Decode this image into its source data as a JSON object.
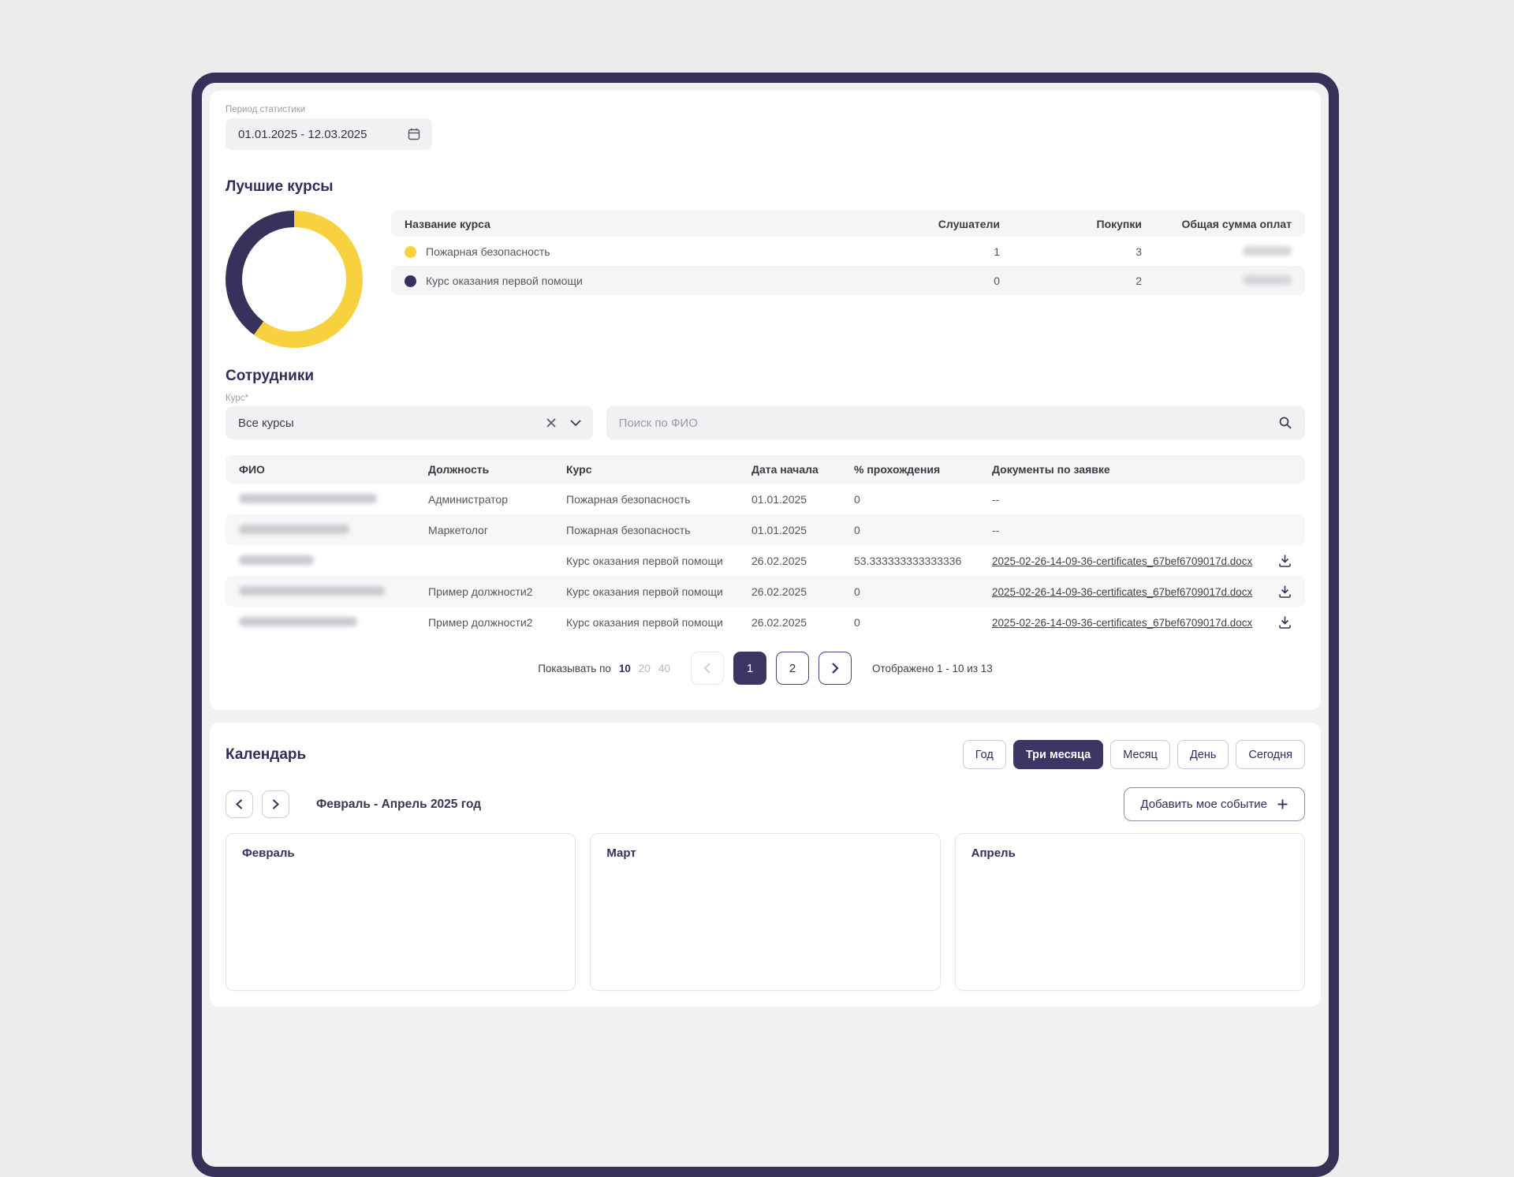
{
  "period": {
    "label": "Период статистики",
    "value": "01.01.2025 - 12.03.2025"
  },
  "best_courses": {
    "title": "Лучшие курсы",
    "chart_data": {
      "type": "pie",
      "categories": [
        "Пожарная безопасность",
        "Курс оказания первой помощи"
      ],
      "values": [
        3,
        2
      ],
      "colors": [
        "#F7D13E",
        "#37325B"
      ],
      "title": "Лучшие курсы"
    },
    "headers": {
      "name": "Название курса",
      "listeners": "Слушатели",
      "purchases": "Покупки",
      "total": "Общая сумма оплат"
    },
    "rows": [
      {
        "name": "Пожарная безопасность",
        "listeners": "1",
        "purchases": "3"
      },
      {
        "name": "Курс оказания первой помощи",
        "listeners": "0",
        "purchases": "2"
      }
    ]
  },
  "employees": {
    "title": "Сотрудники",
    "course_filter": {
      "label": "Курс*",
      "value": "Все курсы"
    },
    "search_placeholder": "Поиск по ФИО",
    "headers": {
      "fio": "ФИО",
      "position": "Должность",
      "course": "Курс",
      "start": "Дата начала",
      "progress": "% прохождения",
      "docs": "Документы по заявке"
    },
    "rows": [
      {
        "position": "Администратор",
        "course": "Пожарная безопасность",
        "start": "01.01.2025",
        "progress": "0",
        "doc": "--"
      },
      {
        "position": "Маркетолог",
        "course": "Пожарная безопасность",
        "start": "01.01.2025",
        "progress": "0",
        "doc": "--"
      },
      {
        "position": "",
        "course": "Курс оказания первой помощи",
        "start": "26.02.2025",
        "progress": "53.333333333333336",
        "doc": "2025-02-26-14-09-36-certificates_67bef6709017d.docx"
      },
      {
        "position": "Пример должности2",
        "course": "Курс оказания первой помощи",
        "start": "26.02.2025",
        "progress": "0",
        "doc": "2025-02-26-14-09-36-certificates_67bef6709017d.docx"
      },
      {
        "position": "Пример должности2",
        "course": "Курс оказания первой помощи",
        "start": "26.02.2025",
        "progress": "0",
        "doc": "2025-02-26-14-09-36-certificates_67bef6709017d.docx"
      }
    ],
    "pagination": {
      "show_label": "Показывать по",
      "options": {
        "o10": "10",
        "o20": "20",
        "o40": "40"
      },
      "pages": {
        "p1": "1",
        "p2": "2"
      },
      "summary": "Отображено 1 - 10 из 13"
    }
  },
  "calendar": {
    "title": "Календарь",
    "views": {
      "year": "Год",
      "three_months": "Три месяца",
      "month": "Месяц",
      "day": "День",
      "today": "Сегодня"
    },
    "range_label": "Февраль - Апрель 2025 год",
    "add_event_label": "Добавить мое событие",
    "months": {
      "m1": "Февраль",
      "m2": "Март",
      "m3": "Апрель"
    }
  },
  "colors": {
    "accent_navy": "#3B3663",
    "accent_yellow": "#F7D13E",
    "field_bg": "#F1F1F3",
    "stripe": "#F5F5F6"
  }
}
